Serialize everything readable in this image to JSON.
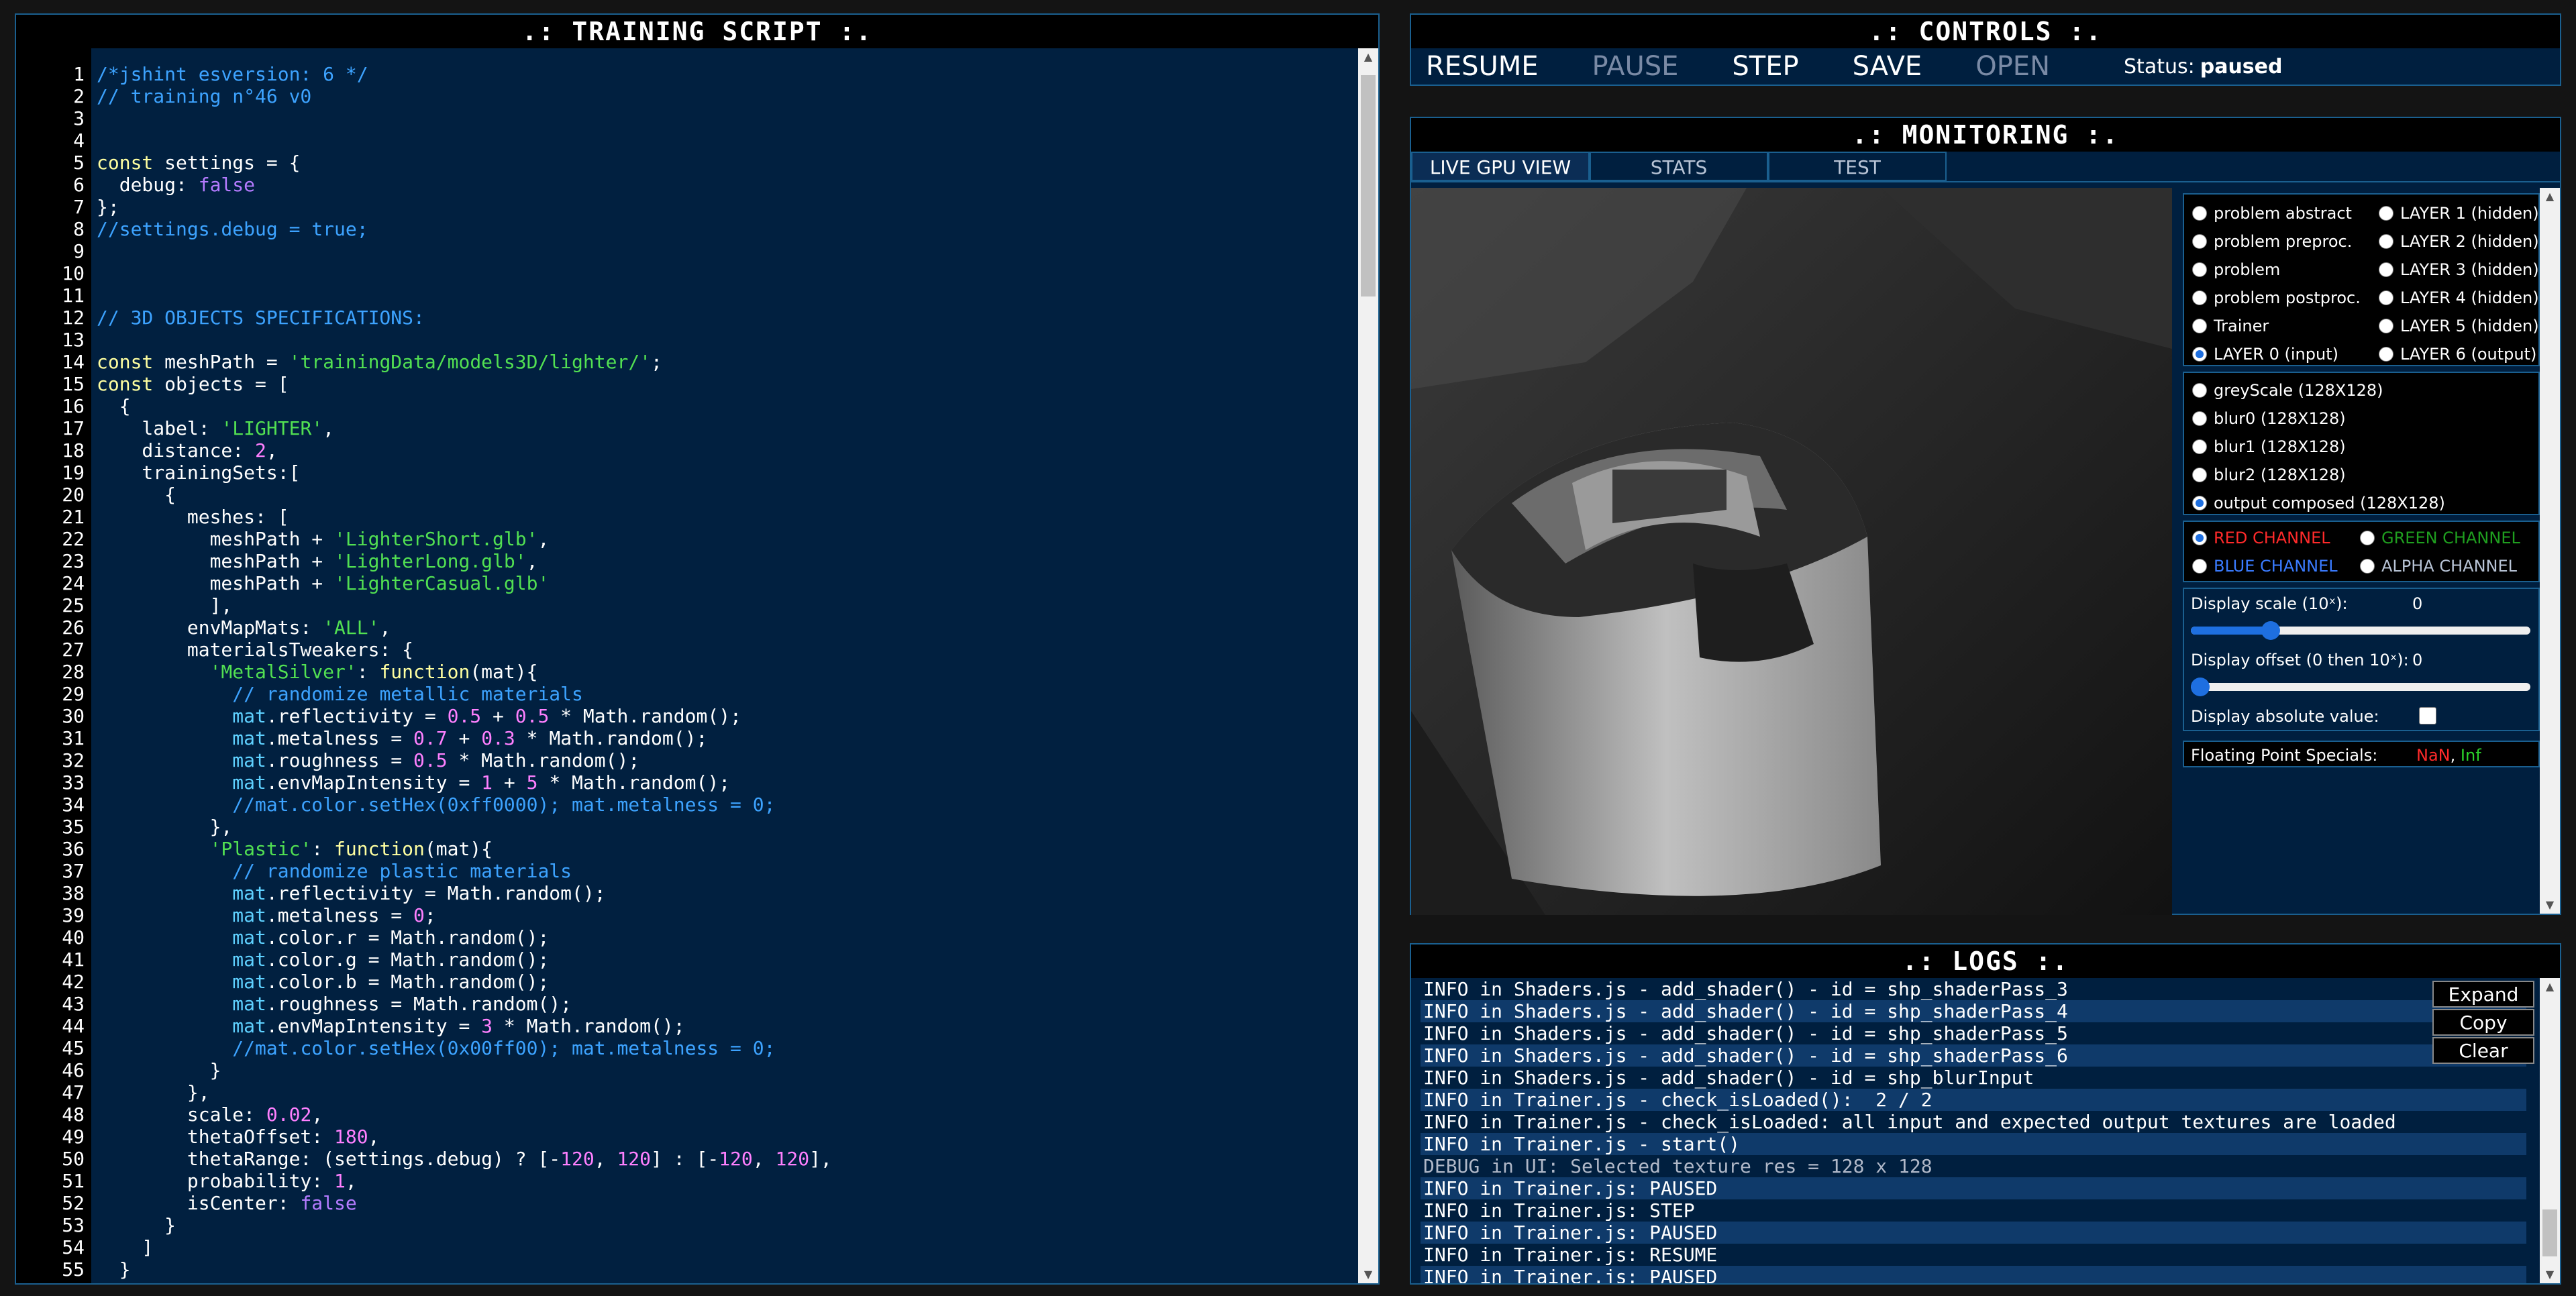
{
  "script_panel": {
    "title": ".: TRAINING SCRIPT :.",
    "lines": [
      [
        {
          "t": "/*jshint esversion: 6 */",
          "c": "cm"
        }
      ],
      [
        {
          "t": "// training n°46 v0",
          "c": "cm"
        }
      ],
      [],
      [],
      [
        {
          "t": "const",
          "c": "kw"
        },
        {
          "t": " settings = {"
        }
      ],
      [
        {
          "t": "  debug: "
        },
        {
          "t": "false",
          "c": "bool"
        }
      ],
      [
        {
          "t": "};"
        }
      ],
      [
        {
          "t": "//settings.debug = true;",
          "c": "cm"
        }
      ],
      [],
      [],
      [],
      [
        {
          "t": "// 3D OBJECTS SPECIFICATIONS:",
          "c": "cm"
        }
      ],
      [],
      [
        {
          "t": "const",
          "c": "kw"
        },
        {
          "t": " meshPath = "
        },
        {
          "t": "'trainingData/models3D/lighter/'",
          "c": "str"
        },
        {
          "t": ";"
        }
      ],
      [
        {
          "t": "const",
          "c": "kw"
        },
        {
          "t": " objects = ["
        }
      ],
      [
        {
          "t": "  {"
        }
      ],
      [
        {
          "t": "    label: "
        },
        {
          "t": "'LIGHTER'",
          "c": "str"
        },
        {
          "t": ","
        }
      ],
      [
        {
          "t": "    distance: "
        },
        {
          "t": "2",
          "c": "num"
        },
        {
          "t": ","
        }
      ],
      [
        {
          "t": "    trainingSets:["
        }
      ],
      [
        {
          "t": "      {"
        }
      ],
      [
        {
          "t": "        meshes: ["
        }
      ],
      [
        {
          "t": "          meshPath + "
        },
        {
          "t": "'LighterShort.glb'",
          "c": "str"
        },
        {
          "t": ","
        }
      ],
      [
        {
          "t": "          meshPath + "
        },
        {
          "t": "'LighterLong.glb'",
          "c": "str"
        },
        {
          "t": ","
        }
      ],
      [
        {
          "t": "          meshPath + "
        },
        {
          "t": "'LighterCasual.glb'",
          "c": "str"
        }
      ],
      [
        {
          "t": "          ],"
        }
      ],
      [
        {
          "t": "        envMapMats: "
        },
        {
          "t": "'ALL'",
          "c": "str"
        },
        {
          "t": ","
        }
      ],
      [
        {
          "t": "        materialsTweakers: {"
        }
      ],
      [
        {
          "t": "          "
        },
        {
          "t": "'MetalSilver'",
          "c": "str"
        },
        {
          "t": ": "
        },
        {
          "t": "function",
          "c": "kw"
        },
        {
          "t": "(mat){"
        }
      ],
      [
        {
          "t": "            "
        },
        {
          "t": "// randomize metallic materials",
          "c": "cm"
        }
      ],
      [
        {
          "t": "            "
        },
        {
          "t": "mat",
          "c": "var"
        },
        {
          "t": ".reflectivity = "
        },
        {
          "t": "0.5",
          "c": "num"
        },
        {
          "t": " + "
        },
        {
          "t": "0.5",
          "c": "num"
        },
        {
          "t": " * Math.random();"
        }
      ],
      [
        {
          "t": "            "
        },
        {
          "t": "mat",
          "c": "var"
        },
        {
          "t": ".metalness = "
        },
        {
          "t": "0.7",
          "c": "num"
        },
        {
          "t": " + "
        },
        {
          "t": "0.3",
          "c": "num"
        },
        {
          "t": " * Math.random();"
        }
      ],
      [
        {
          "t": "            "
        },
        {
          "t": "mat",
          "c": "var"
        },
        {
          "t": ".roughness = "
        },
        {
          "t": "0.5",
          "c": "num"
        },
        {
          "t": " * Math.random();"
        }
      ],
      [
        {
          "t": "            "
        },
        {
          "t": "mat",
          "c": "var"
        },
        {
          "t": ".envMapIntensity = "
        },
        {
          "t": "1",
          "c": "num"
        },
        {
          "t": " + "
        },
        {
          "t": "5",
          "c": "num"
        },
        {
          "t": " * Math.random();"
        }
      ],
      [
        {
          "t": "            "
        },
        {
          "t": "//mat.color.setHex(0xff0000); mat.metalness = 0;",
          "c": "cm"
        }
      ],
      [
        {
          "t": "          },"
        }
      ],
      [
        {
          "t": "          "
        },
        {
          "t": "'Plastic'",
          "c": "str"
        },
        {
          "t": ": "
        },
        {
          "t": "function",
          "c": "kw"
        },
        {
          "t": "(mat){"
        }
      ],
      [
        {
          "t": "            "
        },
        {
          "t": "// randomize plastic materials",
          "c": "cm"
        }
      ],
      [
        {
          "t": "            "
        },
        {
          "t": "mat",
          "c": "var"
        },
        {
          "t": ".reflectivity = Math.random();"
        }
      ],
      [
        {
          "t": "            "
        },
        {
          "t": "mat",
          "c": "var"
        },
        {
          "t": ".metalness = "
        },
        {
          "t": "0",
          "c": "num"
        },
        {
          "t": ";"
        }
      ],
      [
        {
          "t": "            "
        },
        {
          "t": "mat",
          "c": "var"
        },
        {
          "t": ".color.r = Math.random();"
        }
      ],
      [
        {
          "t": "            "
        },
        {
          "t": "mat",
          "c": "var"
        },
        {
          "t": ".color.g = Math.random();"
        }
      ],
      [
        {
          "t": "            "
        },
        {
          "t": "mat",
          "c": "var"
        },
        {
          "t": ".color.b = Math.random();"
        }
      ],
      [
        {
          "t": "            "
        },
        {
          "t": "mat",
          "c": "var"
        },
        {
          "t": ".roughness = Math.random();"
        }
      ],
      [
        {
          "t": "            "
        },
        {
          "t": "mat",
          "c": "var"
        },
        {
          "t": ".envMapIntensity = "
        },
        {
          "t": "3",
          "c": "num"
        },
        {
          "t": " * Math.random();"
        }
      ],
      [
        {
          "t": "            "
        },
        {
          "t": "//mat.color.setHex(0x00ff00); mat.metalness = 0;",
          "c": "cm"
        }
      ],
      [
        {
          "t": "          }"
        }
      ],
      [
        {
          "t": "        },"
        }
      ],
      [
        {
          "t": "        scale: "
        },
        {
          "t": "0.02",
          "c": "num"
        },
        {
          "t": ","
        }
      ],
      [
        {
          "t": "        thetaOffset: "
        },
        {
          "t": "180",
          "c": "num"
        },
        {
          "t": ","
        }
      ],
      [
        {
          "t": "        thetaRange: (settings.debug) ? [-"
        },
        {
          "t": "120",
          "c": "num"
        },
        {
          "t": ", "
        },
        {
          "t": "120",
          "c": "num"
        },
        {
          "t": "] : [-"
        },
        {
          "t": "120",
          "c": "num"
        },
        {
          "t": ", "
        },
        {
          "t": "120",
          "c": "num"
        },
        {
          "t": "],"
        }
      ],
      [
        {
          "t": "        probability: "
        },
        {
          "t": "1",
          "c": "num"
        },
        {
          "t": ","
        }
      ],
      [
        {
          "t": "        isCenter: "
        },
        {
          "t": "false",
          "c": "bool"
        }
      ],
      [
        {
          "t": "      }"
        }
      ],
      [
        {
          "t": "    ]"
        }
      ],
      [
        {
          "t": "  }"
        }
      ],
      [
        {
          "t": "];"
        }
      ]
    ]
  },
  "controls": {
    "title": ".: CONTROLS :.",
    "buttons": [
      {
        "label": "RESUME",
        "enabled": true
      },
      {
        "label": "PAUSE",
        "enabled": false
      },
      {
        "label": "STEP",
        "enabled": true
      },
      {
        "label": "SAVE",
        "enabled": true
      },
      {
        "label": "OPEN",
        "enabled": false
      }
    ],
    "status_label": "Status:",
    "status_value": "paused"
  },
  "monitoring": {
    "title": ".: MONITORING :.",
    "tabs": [
      {
        "label": "LIVE GPU VIEW",
        "active": true
      },
      {
        "label": "STATS",
        "active": false
      },
      {
        "label": "TEST",
        "active": false
      }
    ],
    "layers_left": [
      {
        "label": "problem abstract",
        "checked": false
      },
      {
        "label": "problem preproc.",
        "checked": false
      },
      {
        "label": "problem",
        "checked": false
      },
      {
        "label": "problem postproc.",
        "checked": false
      },
      {
        "label": "Trainer",
        "checked": false
      },
      {
        "label": "LAYER 0 (input)",
        "checked": true
      }
    ],
    "layers_right": [
      {
        "label": "LAYER 1 (hidden)",
        "checked": false
      },
      {
        "label": "LAYER 2 (hidden)",
        "checked": false
      },
      {
        "label": "LAYER 3 (hidden)",
        "checked": false
      },
      {
        "label": "LAYER 4 (hidden)",
        "checked": false
      },
      {
        "label": "LAYER 5 (hidden)",
        "checked": false
      },
      {
        "label": "LAYER 6 (output)",
        "checked": false
      }
    ],
    "textures": [
      {
        "label": "greyScale (128X128)",
        "checked": false
      },
      {
        "label": "blur0 (128X128)",
        "checked": false
      },
      {
        "label": "blur1 (128X128)",
        "checked": false
      },
      {
        "label": "blur2 (128X128)",
        "checked": false
      },
      {
        "label": "output composed (128X128)",
        "checked": true
      }
    ],
    "channels": [
      {
        "label": "RED CHANNEL",
        "color": "#ff2a2a",
        "checked": true
      },
      {
        "label": "GREEN CHANNEL",
        "color": "#1f9f1f",
        "checked": false
      },
      {
        "label": "BLUE CHANNEL",
        "color": "#3a7bff",
        "checked": false
      },
      {
        "label": "ALPHA CHANNEL",
        "color": "#b8c4d6",
        "checked": false
      }
    ],
    "display_scale_label": "Display scale (10ˣ):",
    "display_scale_value": "0",
    "display_scale_fraction": 0.22,
    "display_offset_label": "Display offset (0 then 10ˣ):",
    "display_offset_value": "0",
    "display_offset_fraction": 0.0,
    "display_abs_label": "Display absolute value:",
    "fp_label": "Floating Point Specials:",
    "fp_nan": "NaN",
    "fp_sep": ",",
    "fp_inf": "Inf",
    "fp_nan_color": "#ff2a2a",
    "fp_inf_color": "#2bd42b"
  },
  "logs": {
    "title": ".: LOGS :.",
    "buttons": [
      "Expand",
      "Copy",
      "Clear"
    ],
    "lines": [
      {
        "text": "INFO in Shaders.js - add_shader() - id = shp_shaderPass_3",
        "debug": false
      },
      {
        "text": "INFO in Shaders.js - add_shader() - id = shp_shaderPass_4",
        "debug": false
      },
      {
        "text": "INFO in Shaders.js - add_shader() - id = shp_shaderPass_5",
        "debug": false
      },
      {
        "text": "INFO in Shaders.js - add_shader() - id = shp_shaderPass_6",
        "debug": false
      },
      {
        "text": "INFO in Shaders.js - add_shader() - id = shp_blurInput",
        "debug": false
      },
      {
        "text": "INFO in Trainer.js - check_isLoaded():  2 / 2",
        "debug": false
      },
      {
        "text": "INFO in Trainer.js - check_isLoaded: all input and expected output textures are loaded",
        "debug": false
      },
      {
        "text": "INFO in Trainer.js - start()",
        "debug": false
      },
      {
        "text": "DEBUG in UI: Selected texture res = 128 x 128",
        "debug": true
      },
      {
        "text": "INFO in Trainer.js: PAUSED",
        "debug": false
      },
      {
        "text": "INFO in Trainer.js: STEP",
        "debug": false
      },
      {
        "text": "INFO in Trainer.js: PAUSED",
        "debug": false
      },
      {
        "text": "INFO in Trainer.js: RESUME",
        "debug": false
      },
      {
        "text": "INFO in Trainer.js: PAUSED",
        "debug": false
      }
    ]
  }
}
